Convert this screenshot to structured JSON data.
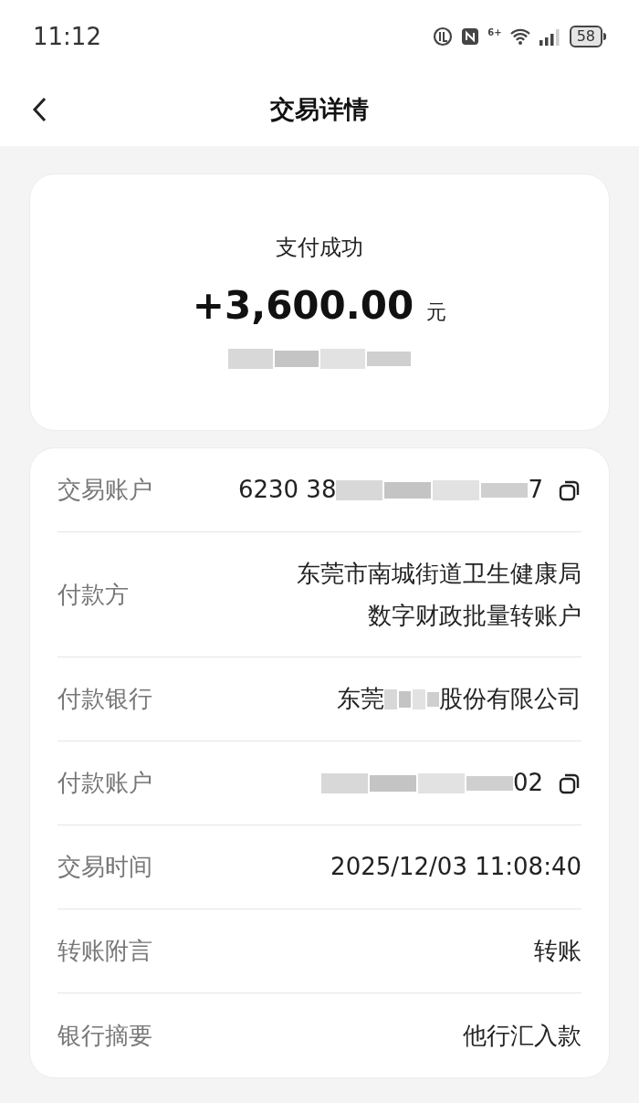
{
  "status_bar": {
    "time": "11:12",
    "wifi_label": "6+",
    "battery": "58"
  },
  "header": {
    "title": "交易详情"
  },
  "summary": {
    "status": "支付成功",
    "amount": "+3,600.00",
    "unit": "元",
    "balance_redacted": true
  },
  "details": [
    {
      "label": "交易账户",
      "copyable": true,
      "value": [
        {
          "kind": "text",
          "text": "6230 38"
        },
        {
          "kind": "redacted"
        },
        {
          "kind": "text",
          "text": "7"
        }
      ]
    },
    {
      "label": "付款方",
      "copyable": false,
      "value": [
        {
          "kind": "line",
          "text": "东莞市南城街道卫生健康局"
        },
        {
          "kind": "line",
          "text": "数字财政批量转账户"
        }
      ]
    },
    {
      "label": "付款银行",
      "copyable": false,
      "value": [
        {
          "kind": "text",
          "text": "东莞"
        },
        {
          "kind": "redacted"
        },
        {
          "kind": "text",
          "text": "股份有限公司"
        }
      ]
    },
    {
      "label": "付款账户",
      "copyable": true,
      "value": [
        {
          "kind": "redacted"
        },
        {
          "kind": "text",
          "text": "02"
        }
      ]
    },
    {
      "label": "交易时间",
      "copyable": false,
      "value": [
        {
          "kind": "text",
          "text": "2025/12/03 11:08:40"
        }
      ]
    },
    {
      "label": "转账附言",
      "copyable": false,
      "value": [
        {
          "kind": "text",
          "text": "转账"
        }
      ]
    },
    {
      "label": "银行摘要",
      "copyable": false,
      "value": [
        {
          "kind": "text",
          "text": "他行汇入款"
        }
      ]
    }
  ]
}
